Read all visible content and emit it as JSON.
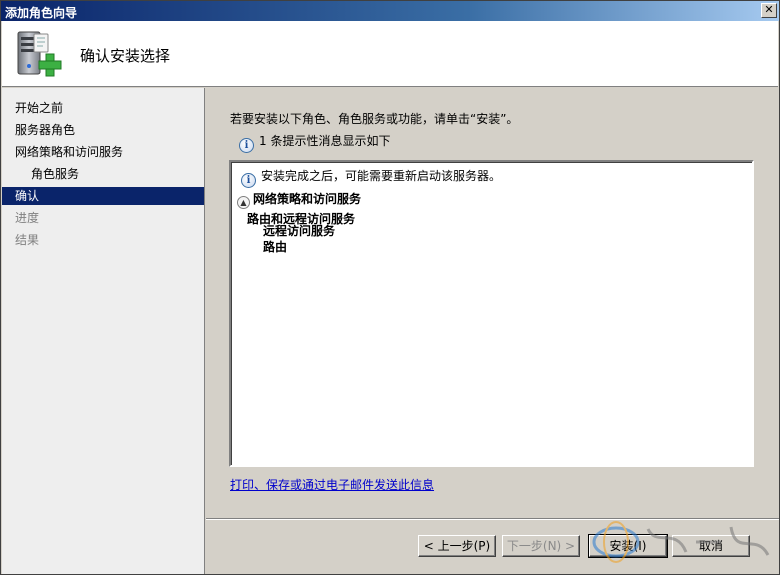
{
  "window": {
    "title": "添加角色向导",
    "close_glyph": "✕"
  },
  "header": {
    "page_title": "确认安装选择",
    "icon": "server-add-role-icon"
  },
  "nav": {
    "items": [
      {
        "label": "开始之前",
        "state": "normal"
      },
      {
        "label": "服务器角色",
        "state": "normal"
      },
      {
        "label": "网络策略和访问服务",
        "state": "normal"
      },
      {
        "label": "角色服务",
        "state": "sub"
      },
      {
        "label": "确认",
        "state": "active"
      },
      {
        "label": "进度",
        "state": "disabled"
      },
      {
        "label": "结果",
        "state": "disabled"
      }
    ]
  },
  "main": {
    "intro": "若要安装以下角色、角色服务或功能，请单击“安装”。",
    "info_count_text": "1 条提示性消息显示如下",
    "listbox": {
      "info_message": "安装完成之后，可能需要重新启动该服务器。",
      "section_title": "网络策略和访问服务",
      "role_name": "路由和远程访问服务",
      "services": [
        "远程访问服务",
        "路由"
      ]
    },
    "link_text": "打印、保存或通过电子邮件发送此信息"
  },
  "footer": {
    "prev_label": "< 上一步(P)",
    "next_label": "下一步(N) >",
    "install_label": "安装(I)",
    "cancel_label": "取消"
  },
  "colors": {
    "title_bar": "#0a246a",
    "nav_active": "#0a246a",
    "link": "#0000cc",
    "face": "#d4d0c8"
  }
}
